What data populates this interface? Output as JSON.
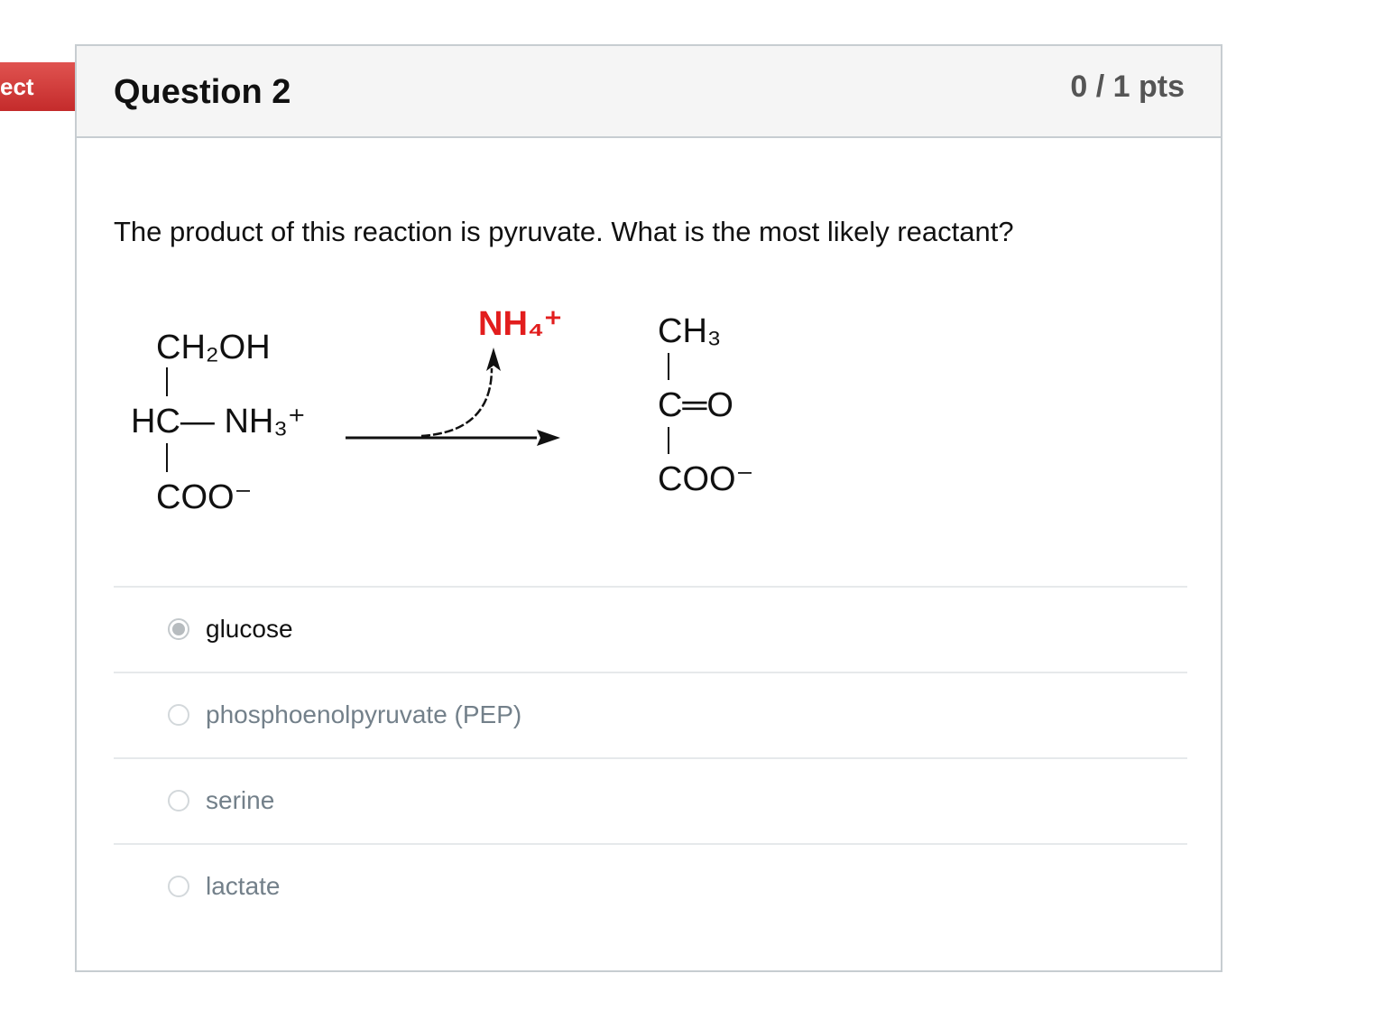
{
  "flag": {
    "label": "ect",
    "color": "#d23c3a"
  },
  "question": {
    "title": "Question 2",
    "points": "0 / 1 pts",
    "text": "The product of this reaction is pyruvate. What is the most likely reactant?"
  },
  "reaction": {
    "reactant": {
      "top": "CH₂OH",
      "middle": "HC— NH₃⁺",
      "bottom": "COO⁻"
    },
    "byproduct": "NH₄⁺",
    "product": {
      "top": "CH₃",
      "middle": "C═O",
      "bottom": "COO⁻"
    },
    "byproduct_color": "#e21d1d"
  },
  "answers": [
    {
      "label": "glucose",
      "selected": true
    },
    {
      "label": "phosphoenolpyruvate (PEP)",
      "selected": false
    },
    {
      "label": "serine",
      "selected": false
    },
    {
      "label": "lactate",
      "selected": false
    }
  ]
}
